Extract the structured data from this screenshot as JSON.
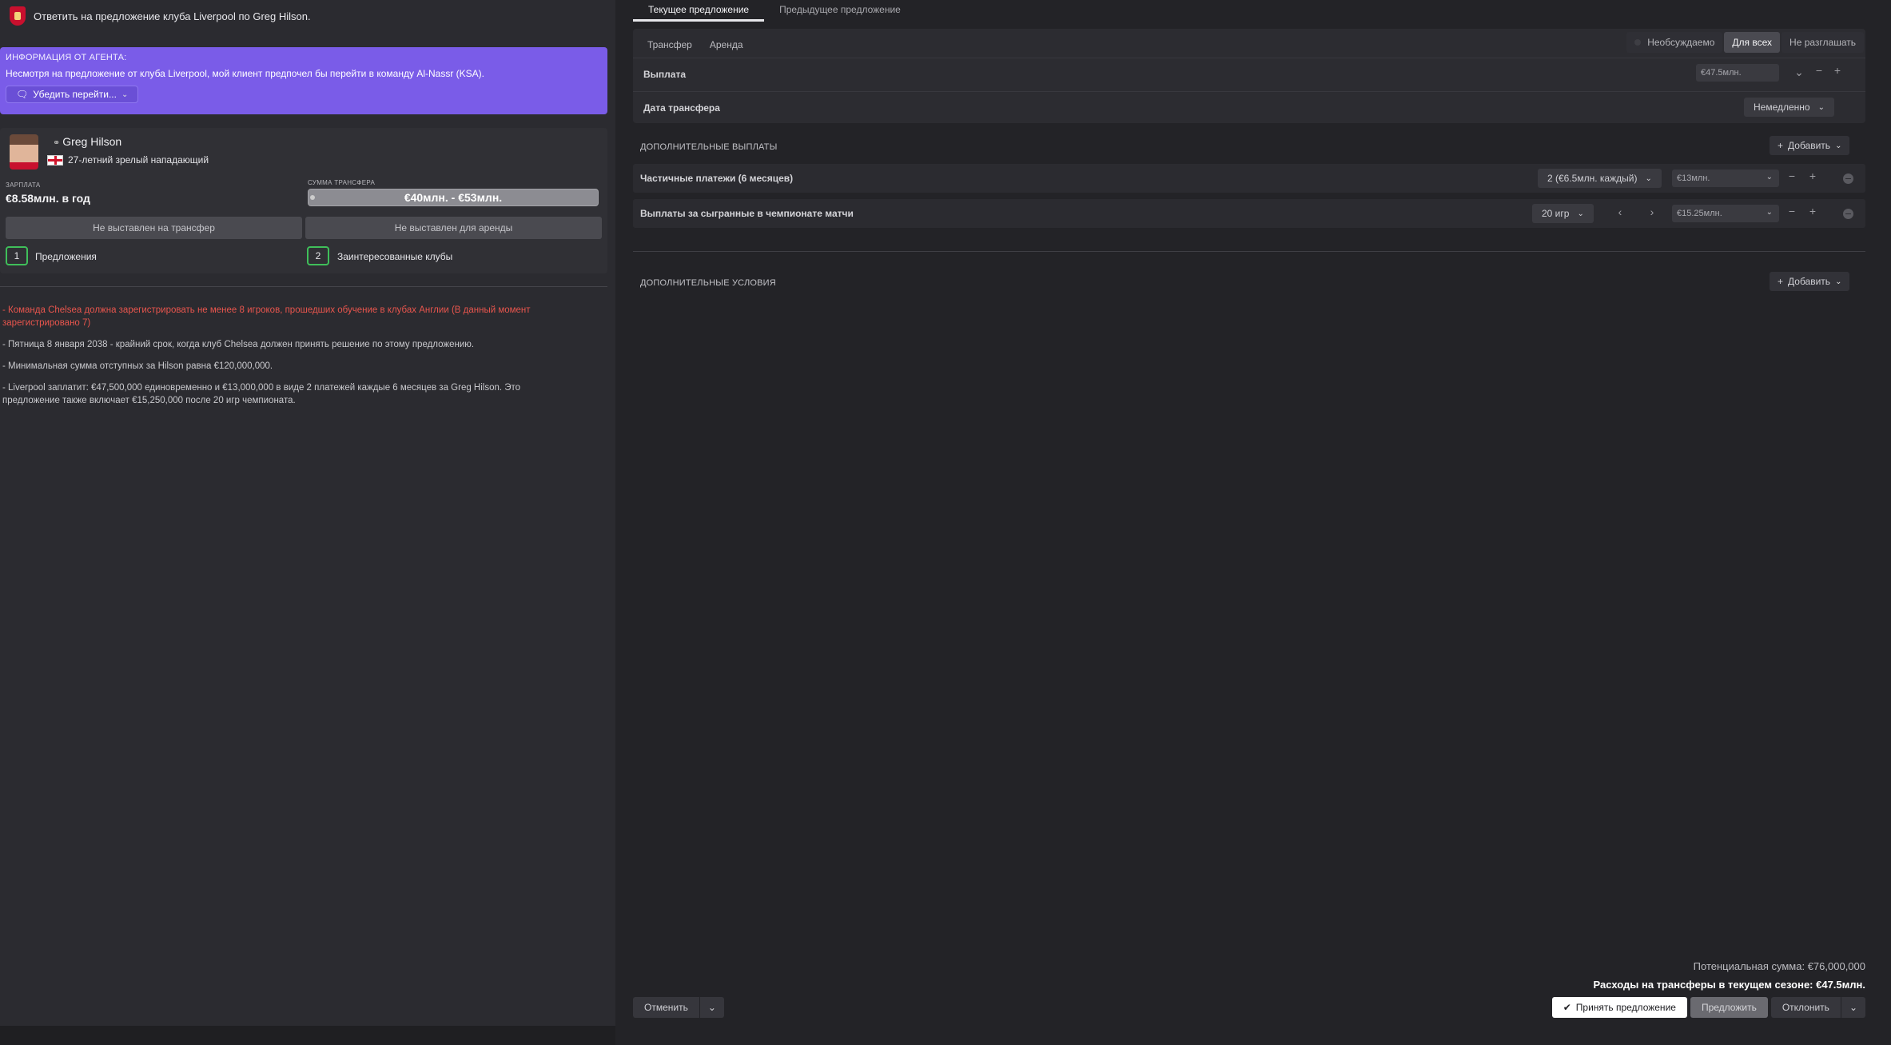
{
  "left": {
    "header_title": "Ответить на предложение клуба Liverpool по Greg Hilson.",
    "agent": {
      "title": "ИНФОРМАЦИЯ ОТ АГЕНТА:",
      "message": "Несмотря на предложение от клуба Liverpool, мой клиент предпочел бы перейти в команду Al-Nassr (KSA).",
      "button_label": "Убедить перейти..."
    },
    "player": {
      "name": "Greg Hilson",
      "description": "27-летний зрелый нападающий",
      "salary_label": "ЗАРПЛАТА",
      "salary_value": "€8.58млн. в год",
      "fee_label": "СУММА ТРАНСФЕРА",
      "fee_value": "€40млн. - €53млн.",
      "transfer_status": "Не выставлен на трансфер",
      "loan_status": "Не выставлен для аренды",
      "offers_count": "1",
      "offers_label": "Предложения",
      "interested_count": "2",
      "interested_label": "Заинтересованные клубы"
    },
    "notes": [
      "- Команда Chelsea должна зарегистрировать не менее 8 игроков, прошедших обучение в клубах Англии (В данный момент зарегистрировано 7)",
      "- Пятница 8 января 2038 - крайний срок, когда клуб Chelsea должен принять решение по этому предложению.",
      "- Минимальная сумма отступных за Hilson равна €120,000,000.",
      "- Liverpool заплатит: €47,500,000 единовременно и €13,000,000 в виде 2 платежей каждые 6 месяцев за Greg Hilson. Это предложение также включает €15,250,000 после 20 игр чемпионата."
    ]
  },
  "right": {
    "tabs": [
      "Текущее предложение",
      "Предыдущее предложение"
    ],
    "type_tabs": [
      "Трансфер",
      "Аренда"
    ],
    "segments": [
      "Необсуждаемо",
      "Для всех",
      "Не разглашать"
    ],
    "payment_label": "Выплата",
    "payment_value": "€47.5млн.",
    "date_label": "Дата трансфера",
    "date_value": "Немедленно",
    "extra_payments_title": "ДОПОЛНИТЕЛЬНЫЕ ВЫПЛАТЫ",
    "add_label": "Добавить",
    "installments_label": "Частичные платежи (6 месяцев)",
    "installments_option": "2 (€6.5млн. каждый)",
    "installments_value": "€13млн.",
    "apps_label": "Выплаты за сыгранные в чемпионате матчи",
    "apps_option": "20 игр",
    "apps_value": "€15.25млн.",
    "extra_terms_title": "ДОПОЛНИТЕЛЬНЫЕ УСЛОВИЯ",
    "potential_total": "Потенциальная сумма: €76,000,000",
    "season_spend": "Расходы на трансферы в текущем сезоне: €47.5млн.",
    "cancel_label": "Отменить",
    "accept_label": "Принять предложение",
    "propose_label": "Предложить",
    "reject_label": "Отклонить"
  },
  "colors": {
    "agent_bg": "#7a5ce8",
    "warning": "#e8554d",
    "count_border": "#3fbf5a"
  }
}
